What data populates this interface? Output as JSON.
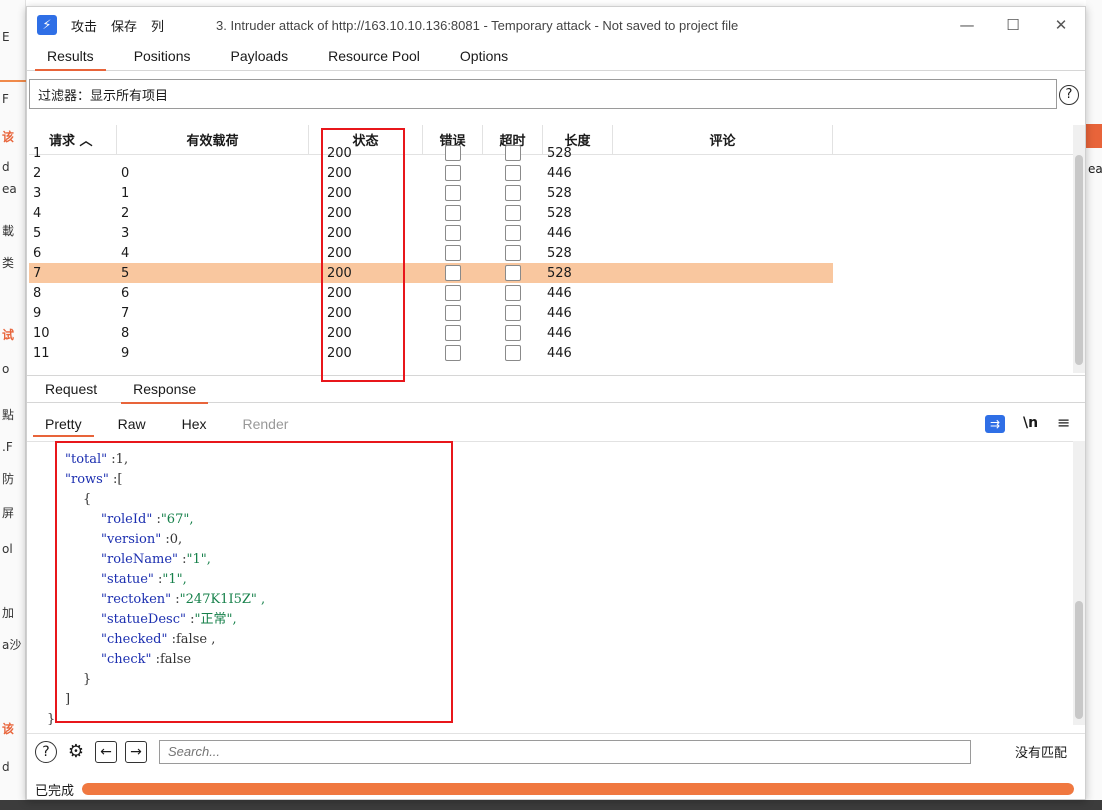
{
  "window": {
    "title": "3. Intruder attack of http://163.10.10.136:8081 - Temporary attack - Not saved to project file",
    "menus": [
      "攻击",
      "保存",
      "列"
    ],
    "controls": {
      "minimize": "—",
      "maximize": "☐",
      "close": "✕"
    }
  },
  "top_tabs": [
    "Results",
    "Positions",
    "Payloads",
    "Resource Pool",
    "Options"
  ],
  "filter": {
    "text": "过滤器：显示所有项目"
  },
  "table": {
    "columns": [
      {
        "label": "请求 ︿"
      },
      {
        "label": "有效载荷"
      },
      {
        "label": "状态"
      },
      {
        "label": "错误"
      },
      {
        "label": "超时"
      },
      {
        "label": "长度"
      },
      {
        "label": "评论"
      }
    ],
    "rows": [
      {
        "req": "1",
        "payload": "",
        "status": "200",
        "length": "528",
        "selected": false
      },
      {
        "req": "2",
        "payload": "0",
        "status": "200",
        "length": "446",
        "selected": false
      },
      {
        "req": "3",
        "payload": "1",
        "status": "200",
        "length": "528",
        "selected": false
      },
      {
        "req": "4",
        "payload": "2",
        "status": "200",
        "length": "528",
        "selected": false
      },
      {
        "req": "5",
        "payload": "3",
        "status": "200",
        "length": "446",
        "selected": false
      },
      {
        "req": "6",
        "payload": "4",
        "status": "200",
        "length": "528",
        "selected": false
      },
      {
        "req": "7",
        "payload": "5",
        "status": "200",
        "length": "528",
        "selected": true
      },
      {
        "req": "8",
        "payload": "6",
        "status": "200",
        "length": "446",
        "selected": false
      },
      {
        "req": "9",
        "payload": "7",
        "status": "200",
        "length": "446",
        "selected": false
      },
      {
        "req": "10",
        "payload": "8",
        "status": "200",
        "length": "446",
        "selected": false
      },
      {
        "req": "11",
        "payload": "9",
        "status": "200",
        "length": "446",
        "selected": false
      }
    ]
  },
  "mid_tabs": [
    "Request",
    "Response"
  ],
  "view_tabs": [
    "Pretty",
    "Raw",
    "Hex",
    "Render"
  ],
  "view_icons": {
    "wrap": "wrap-icon",
    "newline": "\\n",
    "menu": "≡"
  },
  "code_lines": [
    {
      "indent": 1,
      "key": "\"total\"",
      "sep": " :",
      "val": "1,",
      "vtype": "v"
    },
    {
      "indent": 1,
      "key": "\"rows\"",
      "sep": " :",
      "val": "[",
      "vtype": "p"
    },
    {
      "indent": 2,
      "key": "",
      "sep": "",
      "val": "{",
      "vtype": "p"
    },
    {
      "indent": 3,
      "key": "\"roleId\"",
      "sep": " :",
      "val": "\"67\",",
      "vtype": "s"
    },
    {
      "indent": 3,
      "key": "\"version\"",
      "sep": " :",
      "val": "0,",
      "vtype": "v"
    },
    {
      "indent": 3,
      "key": "\"roleName\"",
      "sep": " :",
      "val": "\"1\",",
      "vtype": "s"
    },
    {
      "indent": 3,
      "key": "\"statue\"",
      "sep": " :",
      "val": "\"1\",",
      "vtype": "s"
    },
    {
      "indent": 3,
      "key": "\"rectoken\"",
      "sep": " :",
      "val": "\"247K1I5Z\" ,",
      "vtype": "s"
    },
    {
      "indent": 3,
      "key": "\"statueDesc\"",
      "sep": " :",
      "val": "\"正常\",",
      "vtype": "s"
    },
    {
      "indent": 3,
      "key": "\"checked\"",
      "sep": " :",
      "val": "false ,",
      "vtype": "v"
    },
    {
      "indent": 3,
      "key": "\"check\"",
      "sep": " :",
      "val": "false",
      "vtype": "v"
    },
    {
      "indent": 2,
      "key": "",
      "sep": "",
      "val": "}",
      "vtype": "p"
    },
    {
      "indent": 1,
      "key": "",
      "sep": "",
      "val": "]",
      "vtype": "p"
    },
    {
      "indent": 0,
      "key": "",
      "sep": "",
      "val": "}",
      "vtype": "p"
    }
  ],
  "search": {
    "placeholder": "Search...",
    "match_text": "没有匹配"
  },
  "status": {
    "text": "已完成",
    "progress": 1.0
  },
  "colors": {
    "accent": "#e8643a",
    "selected_row": "#f9c79f",
    "highlight_box": "#e8161b",
    "app_icon": "#2f6fe6"
  }
}
